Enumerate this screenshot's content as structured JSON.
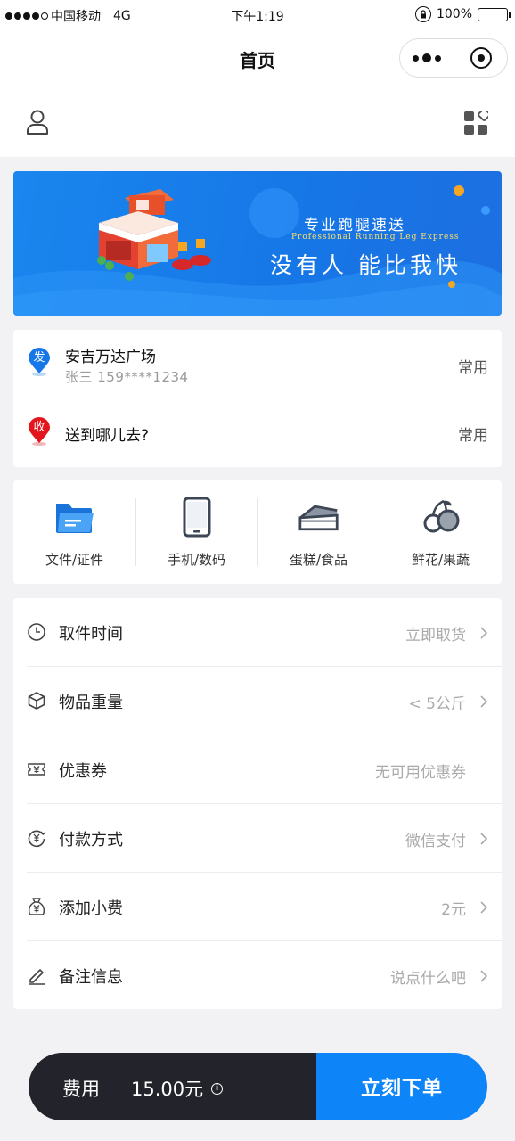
{
  "status_bar": {
    "carrier": "中国移动",
    "network": "4G",
    "time": "下午1:19",
    "battery": "100%"
  },
  "nav": {
    "title": "首页"
  },
  "banner": {
    "headline": "专业跑腿速送",
    "subtitle_en": "Professional Running Leg Express",
    "slogan": "没有人 能比我快"
  },
  "address": {
    "sender": {
      "badge": "发",
      "title": "安吉万达广场",
      "contact": "张三   159****1234",
      "action": "常用",
      "color": "#1677e8"
    },
    "receiver": {
      "badge": "收",
      "title": "送到哪儿去?",
      "action": "常用",
      "color": "#e4151c"
    }
  },
  "categories": [
    {
      "label": "文件/证件",
      "icon": "folder-icon"
    },
    {
      "label": "手机/数码",
      "icon": "phone-icon"
    },
    {
      "label": "蛋糕/食品",
      "icon": "cake-icon"
    },
    {
      "label": "鲜花/果蔬",
      "icon": "fruit-icon"
    }
  ],
  "form": {
    "pickup_time": {
      "label": "取件时间",
      "value": "立即取货",
      "icon": "clock-icon"
    },
    "weight": {
      "label": "物品重量",
      "value": "< 5公斤",
      "icon": "box-icon"
    },
    "coupon": {
      "label": "优惠券",
      "value": "无可用优惠券",
      "icon": "ticket-icon"
    },
    "payment": {
      "label": "付款方式",
      "value": "微信支付",
      "icon": "yuan-circle-icon"
    },
    "tip": {
      "label": "添加小费",
      "value": "2元",
      "icon": "money-bag-icon"
    },
    "remark": {
      "label": "备注信息",
      "value": "说点什么吧",
      "icon": "pencil-icon"
    }
  },
  "footer": {
    "fee_label": "费用",
    "fee_value": "15.00元",
    "submit_label": "立刻下单",
    "accent": "#0d84f7"
  }
}
